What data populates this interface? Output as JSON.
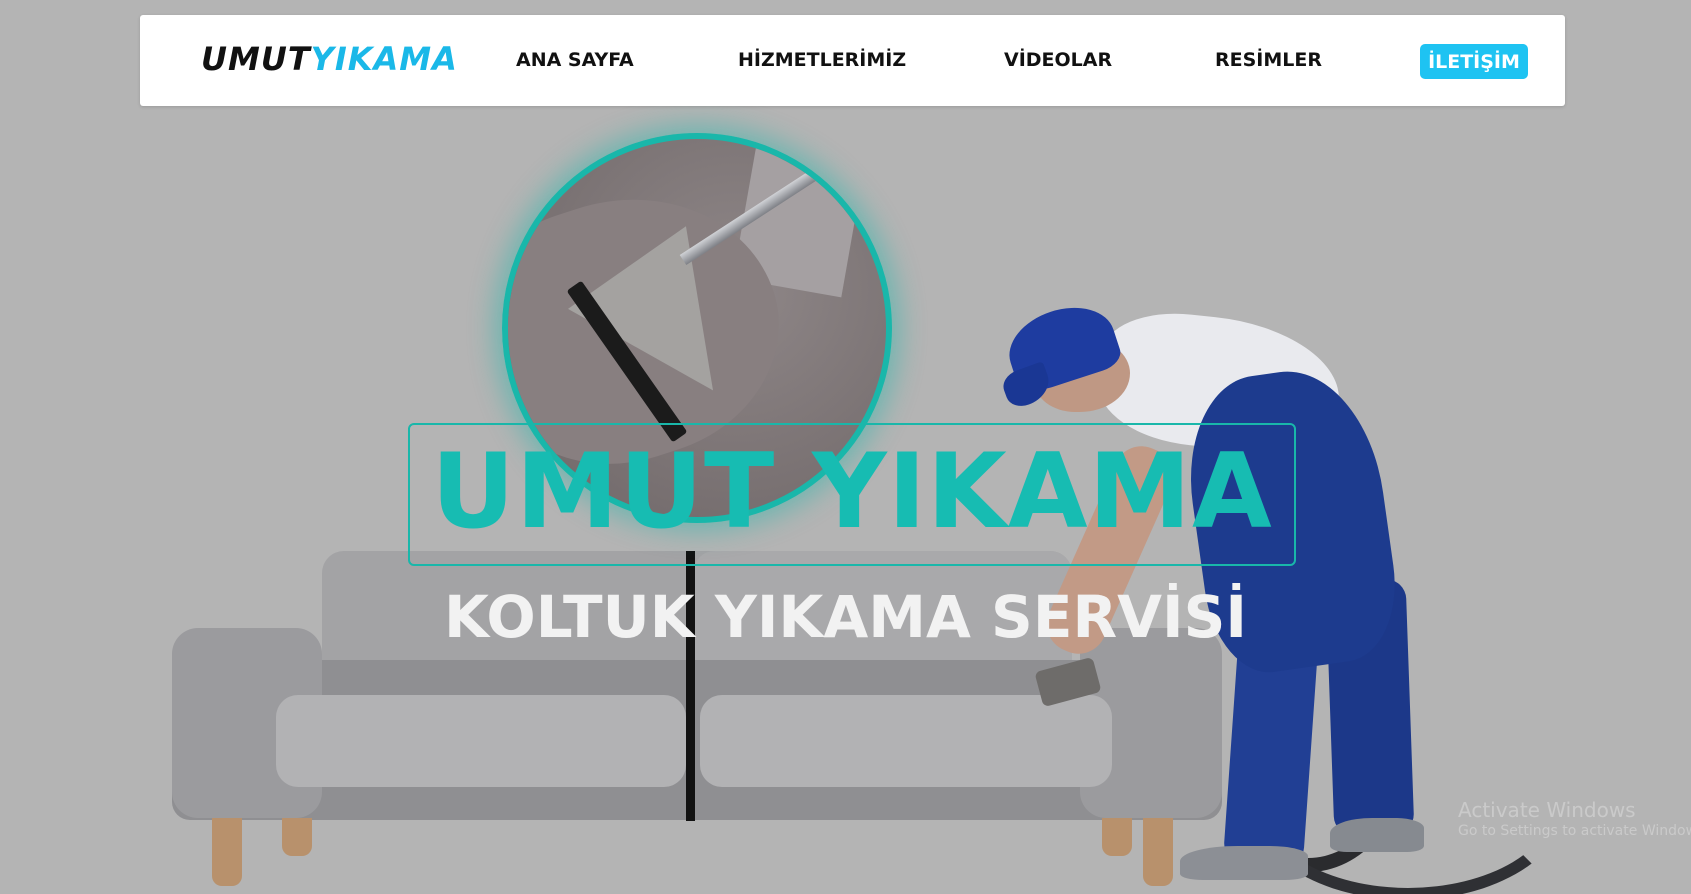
{
  "logo": {
    "part1": "UMUT",
    "part2": "YIKAMA"
  },
  "nav": {
    "home": "ANA SAYFA",
    "services": "HİZMETLERİMİZ",
    "videos": "VİDEOLAR",
    "images": "RESİMLER",
    "contact": "İLETİŞİM"
  },
  "hero": {
    "title": "UMUT YIKAMA",
    "subtitle": "KOLTUK YIKAMA SERVİSİ"
  },
  "watermark": {
    "line1": "Activate Windows",
    "line2": "Go to Settings to activate Windows."
  },
  "colors": {
    "accent_blue": "#1ec3f2",
    "accent_teal": "#17bcb2",
    "page_background": "#b4b4b4"
  }
}
